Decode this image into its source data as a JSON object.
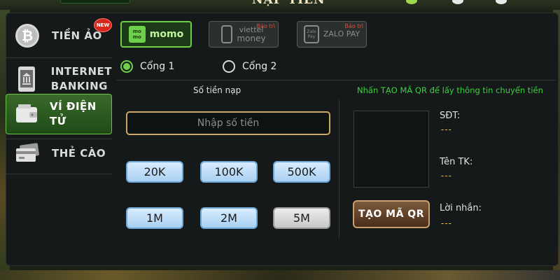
{
  "header": {
    "title": "NẠP TIỀN"
  },
  "sidebar": {
    "items": [
      {
        "label": "TIỀN ẢO",
        "icon": "bitcoin-icon",
        "badge": "NEW"
      },
      {
        "label_line1": "INTERNET",
        "label_line2": "BANKING",
        "icon": "bank-phone-icon"
      },
      {
        "label": "VÍ ĐIỆN TỬ",
        "icon": "wallet-icon",
        "active": true
      },
      {
        "label": "THẺ CÀO",
        "icon": "card-icon"
      }
    ]
  },
  "providers": [
    {
      "name": "momo",
      "logo_text": "mo mo",
      "active": true
    },
    {
      "name": "viettel money",
      "line1": "viettel",
      "line2": "money",
      "status": "Bảo trì"
    },
    {
      "name": "ZALO PAY",
      "line1": "Zalo Pay",
      "line2": "ZALO PAY",
      "status": "Bảo trì"
    }
  ],
  "ports": [
    {
      "label": "Cổng 1",
      "selected": true
    },
    {
      "label": "Cổng 2",
      "selected": false
    }
  ],
  "amount": {
    "section_title": "Số tiền nạp",
    "placeholder": "Nhập số tiền",
    "presets": [
      "20K",
      "100K",
      "500K",
      "1M",
      "2M",
      "5M"
    ]
  },
  "qr": {
    "hint": "Nhấn TẠO MÃ QR để lấy thông tin chuyển tiền",
    "button_label": "TẠO MÃ QR",
    "fields": [
      {
        "label": "SĐT:",
        "value": "---"
      },
      {
        "label": "Tên TK:",
        "value": "---"
      },
      {
        "label": "Lời nhắn:",
        "value": "---"
      }
    ]
  },
  "colors": {
    "accent": "#6ed04a",
    "hint": "#3fd03f",
    "value": "#e6c23a",
    "maintenance": "#e04a3a"
  }
}
